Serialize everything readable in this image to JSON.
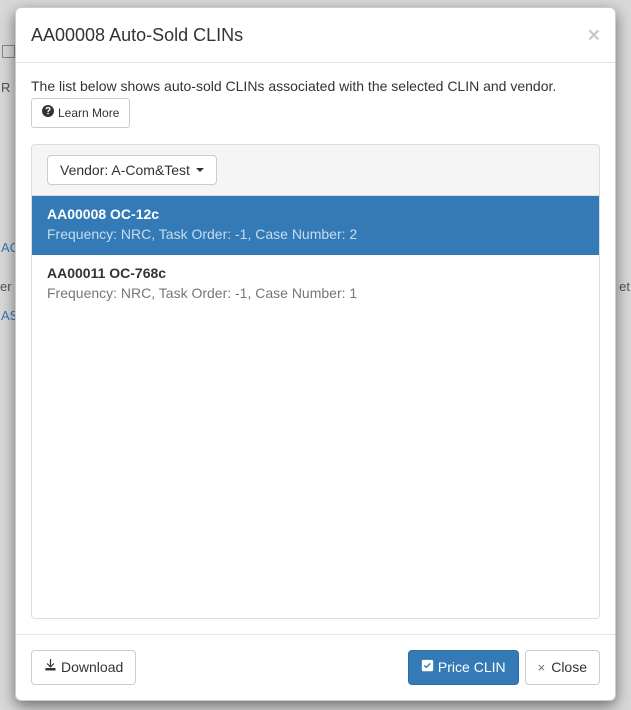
{
  "modal": {
    "title": "AA00008 Auto-Sold CLINs",
    "close_symbol": "×",
    "description": "The list below shows auto-sold CLINs associated with the selected CLIN and vendor.",
    "learn_more_label": "Learn More"
  },
  "vendor_selector": {
    "label": "Vendor: A-Com&Test"
  },
  "clin_list": [
    {
      "title": "AA00008 OC-12c",
      "subtitle": "Frequency: NRC, Task Order: -1, Case Number: 2",
      "active": true
    },
    {
      "title": "AA00011 OC-768c",
      "subtitle": "Frequency: NRC, Task Order: -1, Case Number: 1",
      "active": false
    }
  ],
  "footer": {
    "download_label": "Download",
    "price_clin_label": "Price CLIN",
    "close_label": "Close"
  }
}
